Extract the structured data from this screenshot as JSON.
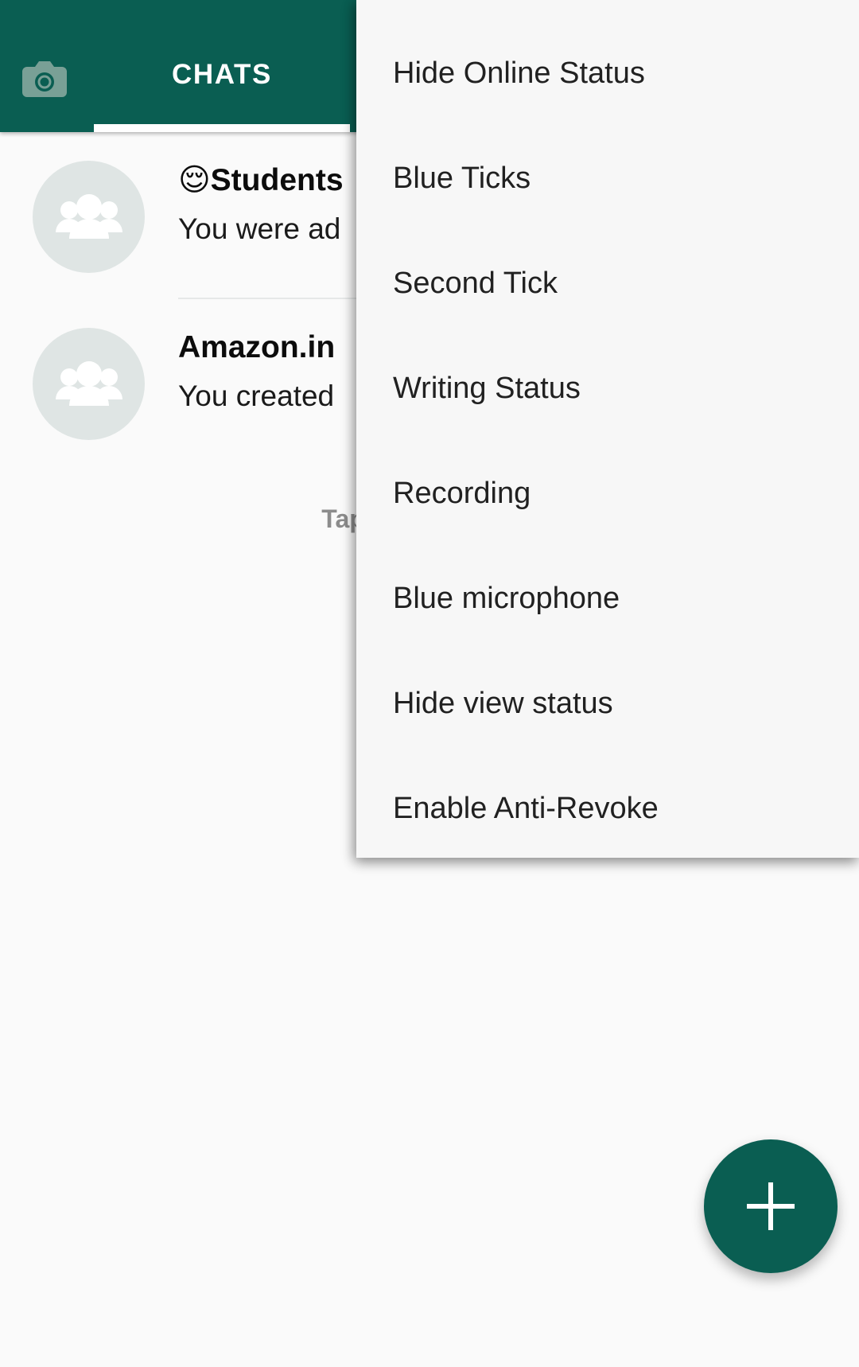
{
  "app": {
    "name": "WhatsApp (modded)",
    "accent_color": "#0a5e52",
    "background_color": "#fafafa"
  },
  "appbar": {
    "camera_icon": "camera-icon",
    "camera_icon_color": "#79a096",
    "tab": {
      "label": "CHATS",
      "selected": true,
      "indicator_color": "#ffffff"
    }
  },
  "chat_list": {
    "hint_text": "Tap and hold on a",
    "divider_color": "#e6e8e8",
    "rows": [
      {
        "avatar_icon": "group-avatar-icon",
        "emoji": "😌",
        "title": "Students",
        "subtitle": "You were ad"
      },
      {
        "avatar_icon": "group-avatar-icon",
        "emoji": "",
        "title": "Amazon.in",
        "subtitle": "You created"
      }
    ]
  },
  "fab": {
    "icon": "plus-icon",
    "label": "+",
    "color": "#0a5e52"
  },
  "popup_menu": {
    "background_color": "#f7f7f7",
    "items": [
      {
        "label": "Hide Online Status"
      },
      {
        "label": "Blue Ticks"
      },
      {
        "label": "Second Tick"
      },
      {
        "label": "Writing Status"
      },
      {
        "label": "Recording"
      },
      {
        "label": "Blue microphone"
      },
      {
        "label": "Hide view status"
      },
      {
        "label": "Enable Anti-Revoke"
      }
    ]
  }
}
